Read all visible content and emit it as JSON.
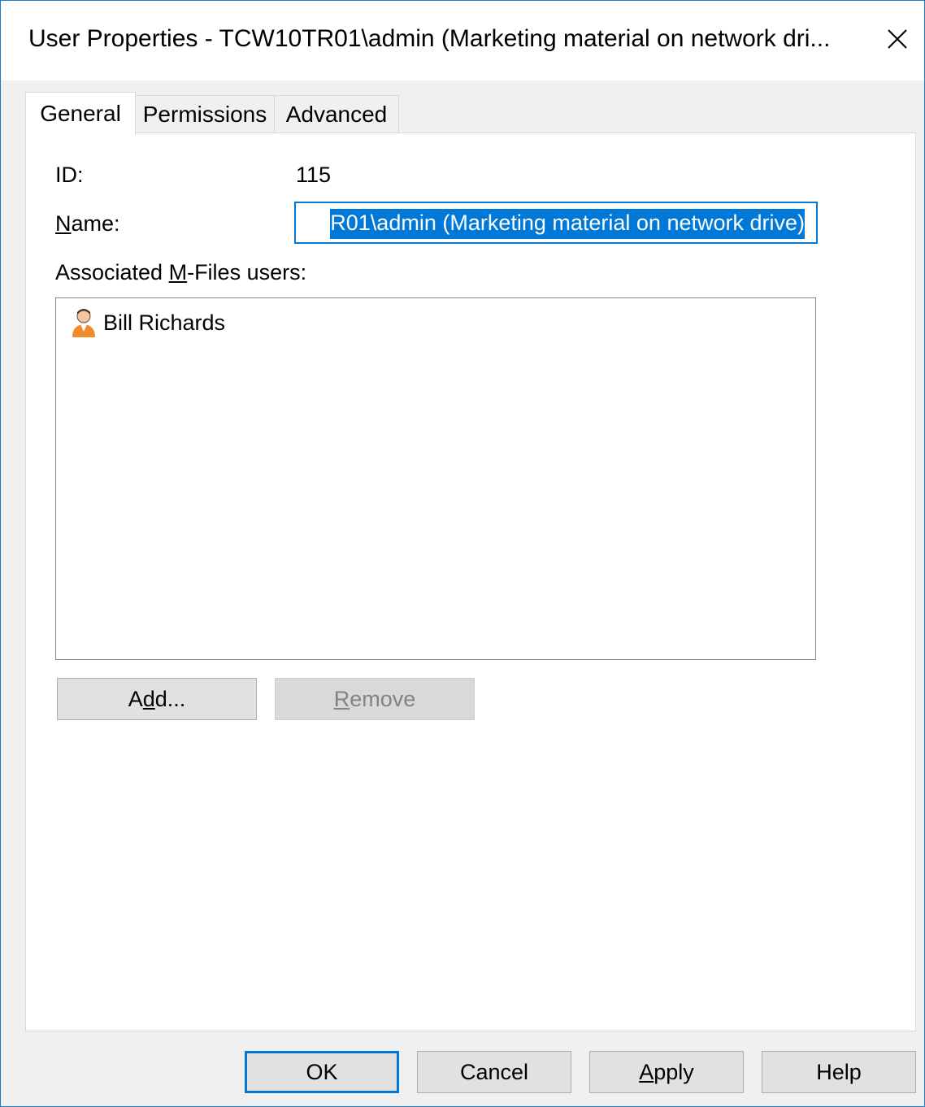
{
  "window": {
    "title": "User Properties - TCW10TR01\\admin (Marketing material on network dri...",
    "close_label": "×"
  },
  "tabs": [
    {
      "label": "General",
      "active": true
    },
    {
      "label": "Permissions",
      "active": false
    },
    {
      "label": "Advanced",
      "active": false
    }
  ],
  "general": {
    "id_label": "ID:",
    "id_value": "115",
    "name_label_pre": "",
    "name_label_ul": "N",
    "name_label_post": "ame:",
    "name_value": "R01\\admin (Marketing material on network drive)",
    "associated_label_pre": "Associated ",
    "associated_label_ul": "M",
    "associated_label_post": "-Files users:",
    "users": [
      {
        "name": "Bill Richards",
        "icon": "user-icon"
      }
    ],
    "add_button_pre": "A",
    "add_button_ul": "d",
    "add_button_post": "d...",
    "remove_button_pre": "",
    "remove_button_ul": "R",
    "remove_button_post": "emove"
  },
  "footer": {
    "ok_label": "OK",
    "cancel_label": "Cancel",
    "apply_label_ul": "A",
    "apply_label_post": "pply",
    "help_label": "Help"
  },
  "colors": {
    "accent": "#0078d7",
    "window_border": "#1979ca",
    "user_icon": "#f08a2c"
  }
}
